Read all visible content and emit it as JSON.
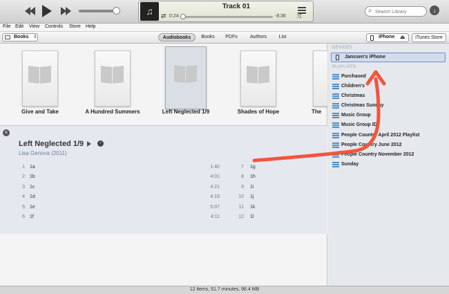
{
  "player": {
    "track_title": "Track 01",
    "time_elapsed": "0:24",
    "time_remaining": "-8:36",
    "progress": 0.05,
    "volume": 0.9
  },
  "search": {
    "placeholder": "Search Library"
  },
  "menu": [
    "File",
    "Edit",
    "View",
    "Controls",
    "Store",
    "Help"
  ],
  "toolbar": {
    "library_label": "Books",
    "tabs": [
      "Audiobooks",
      "Books",
      "PDFs",
      "Authors",
      "List"
    ],
    "selected_tab": "Audiobooks",
    "device_button": "iPhone",
    "store_button": "iTunes Store"
  },
  "books": [
    {
      "title": "Give and Take"
    },
    {
      "title": "A Hundred Summers"
    },
    {
      "title": "Left Neglected 1/9"
    },
    {
      "title": "Shades of Hope"
    },
    {
      "title": "The"
    }
  ],
  "detail": {
    "title": "Left Neglected 1/9",
    "author": "Lisa Genova (2011)",
    "tracks_left": [
      {
        "num": "1",
        "name": "1a",
        "time": "1:40"
      },
      {
        "num": "2",
        "name": "1b",
        "time": "4:01"
      },
      {
        "num": "3",
        "name": "1c",
        "time": "4:21"
      },
      {
        "num": "4",
        "name": "1d",
        "time": "4:19"
      },
      {
        "num": "5",
        "name": "1e",
        "time": "5:07"
      },
      {
        "num": "6",
        "name": "1f",
        "time": "4:11"
      }
    ],
    "tracks_right": [
      {
        "num": "7",
        "name": "1g"
      },
      {
        "num": "8",
        "name": "1h"
      },
      {
        "num": "9",
        "name": "1i"
      },
      {
        "num": "10",
        "name": "1j"
      },
      {
        "num": "11",
        "name": "1k"
      },
      {
        "num": "12",
        "name": "1l"
      }
    ]
  },
  "sidebar": {
    "devices_header": "DEVICES",
    "device_name": "Janssen's iPhone",
    "playlists_header": "PLAYLISTS",
    "playlists": [
      "Purchased",
      "Children's",
      "Christmas",
      "Christmas Sunday",
      "Music Group",
      "Music Group ID",
      "People Country April 2012 Playlist",
      "People Country June 2012",
      "People Country November 2012",
      "Sunday"
    ]
  },
  "status": "12 items, 51.7 minutes, 96.4 MB",
  "colors": {
    "annotation_arrow": "#f2553f",
    "selection_border": "#6f8fc5"
  },
  "icons": [
    "previous-icon",
    "play-icon",
    "next-icon",
    "music-note-icon",
    "repeat-icon",
    "shuffle-icon",
    "list-view-icon",
    "search-icon",
    "download-icon",
    "book-icon",
    "iphone-icon",
    "eject-icon",
    "close-icon",
    "arrow-circle-icon",
    "playlist-icon"
  ]
}
